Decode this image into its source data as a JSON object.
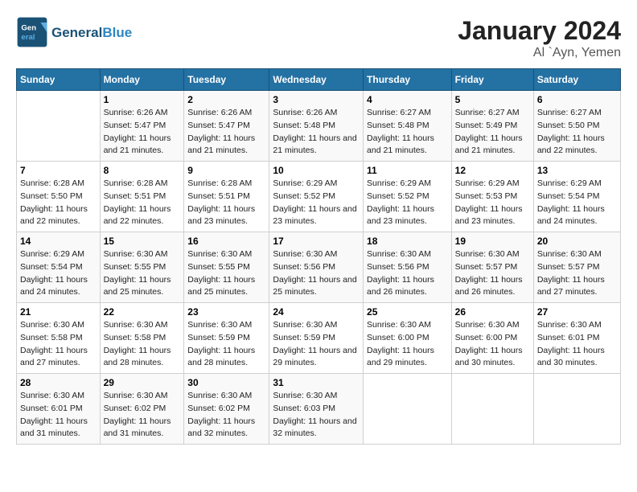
{
  "header": {
    "logo_general": "General",
    "logo_blue": "Blue",
    "title": "January 2024",
    "subtitle": "Al `Ayn, Yemen"
  },
  "days_of_week": [
    "Sunday",
    "Monday",
    "Tuesday",
    "Wednesday",
    "Thursday",
    "Friday",
    "Saturday"
  ],
  "weeks": [
    [
      {
        "day": "",
        "sunrise": "",
        "sunset": "",
        "daylight": ""
      },
      {
        "day": "1",
        "sunrise": "Sunrise: 6:26 AM",
        "sunset": "Sunset: 5:47 PM",
        "daylight": "Daylight: 11 hours and 21 minutes."
      },
      {
        "day": "2",
        "sunrise": "Sunrise: 6:26 AM",
        "sunset": "Sunset: 5:47 PM",
        "daylight": "Daylight: 11 hours and 21 minutes."
      },
      {
        "day": "3",
        "sunrise": "Sunrise: 6:26 AM",
        "sunset": "Sunset: 5:48 PM",
        "daylight": "Daylight: 11 hours and 21 minutes."
      },
      {
        "day": "4",
        "sunrise": "Sunrise: 6:27 AM",
        "sunset": "Sunset: 5:48 PM",
        "daylight": "Daylight: 11 hours and 21 minutes."
      },
      {
        "day": "5",
        "sunrise": "Sunrise: 6:27 AM",
        "sunset": "Sunset: 5:49 PM",
        "daylight": "Daylight: 11 hours and 21 minutes."
      },
      {
        "day": "6",
        "sunrise": "Sunrise: 6:27 AM",
        "sunset": "Sunset: 5:50 PM",
        "daylight": "Daylight: 11 hours and 22 minutes."
      }
    ],
    [
      {
        "day": "7",
        "sunrise": "Sunrise: 6:28 AM",
        "sunset": "Sunset: 5:50 PM",
        "daylight": "Daylight: 11 hours and 22 minutes."
      },
      {
        "day": "8",
        "sunrise": "Sunrise: 6:28 AM",
        "sunset": "Sunset: 5:51 PM",
        "daylight": "Daylight: 11 hours and 22 minutes."
      },
      {
        "day": "9",
        "sunrise": "Sunrise: 6:28 AM",
        "sunset": "Sunset: 5:51 PM",
        "daylight": "Daylight: 11 hours and 23 minutes."
      },
      {
        "day": "10",
        "sunrise": "Sunrise: 6:29 AM",
        "sunset": "Sunset: 5:52 PM",
        "daylight": "Daylight: 11 hours and 23 minutes."
      },
      {
        "day": "11",
        "sunrise": "Sunrise: 6:29 AM",
        "sunset": "Sunset: 5:52 PM",
        "daylight": "Daylight: 11 hours and 23 minutes."
      },
      {
        "day": "12",
        "sunrise": "Sunrise: 6:29 AM",
        "sunset": "Sunset: 5:53 PM",
        "daylight": "Daylight: 11 hours and 23 minutes."
      },
      {
        "day": "13",
        "sunrise": "Sunrise: 6:29 AM",
        "sunset": "Sunset: 5:54 PM",
        "daylight": "Daylight: 11 hours and 24 minutes."
      }
    ],
    [
      {
        "day": "14",
        "sunrise": "Sunrise: 6:29 AM",
        "sunset": "Sunset: 5:54 PM",
        "daylight": "Daylight: 11 hours and 24 minutes."
      },
      {
        "day": "15",
        "sunrise": "Sunrise: 6:30 AM",
        "sunset": "Sunset: 5:55 PM",
        "daylight": "Daylight: 11 hours and 25 minutes."
      },
      {
        "day": "16",
        "sunrise": "Sunrise: 6:30 AM",
        "sunset": "Sunset: 5:55 PM",
        "daylight": "Daylight: 11 hours and 25 minutes."
      },
      {
        "day": "17",
        "sunrise": "Sunrise: 6:30 AM",
        "sunset": "Sunset: 5:56 PM",
        "daylight": "Daylight: 11 hours and 25 minutes."
      },
      {
        "day": "18",
        "sunrise": "Sunrise: 6:30 AM",
        "sunset": "Sunset: 5:56 PM",
        "daylight": "Daylight: 11 hours and 26 minutes."
      },
      {
        "day": "19",
        "sunrise": "Sunrise: 6:30 AM",
        "sunset": "Sunset: 5:57 PM",
        "daylight": "Daylight: 11 hours and 26 minutes."
      },
      {
        "day": "20",
        "sunrise": "Sunrise: 6:30 AM",
        "sunset": "Sunset: 5:57 PM",
        "daylight": "Daylight: 11 hours and 27 minutes."
      }
    ],
    [
      {
        "day": "21",
        "sunrise": "Sunrise: 6:30 AM",
        "sunset": "Sunset: 5:58 PM",
        "daylight": "Daylight: 11 hours and 27 minutes."
      },
      {
        "day": "22",
        "sunrise": "Sunrise: 6:30 AM",
        "sunset": "Sunset: 5:58 PM",
        "daylight": "Daylight: 11 hours and 28 minutes."
      },
      {
        "day": "23",
        "sunrise": "Sunrise: 6:30 AM",
        "sunset": "Sunset: 5:59 PM",
        "daylight": "Daylight: 11 hours and 28 minutes."
      },
      {
        "day": "24",
        "sunrise": "Sunrise: 6:30 AM",
        "sunset": "Sunset: 5:59 PM",
        "daylight": "Daylight: 11 hours and 29 minutes."
      },
      {
        "day": "25",
        "sunrise": "Sunrise: 6:30 AM",
        "sunset": "Sunset: 6:00 PM",
        "daylight": "Daylight: 11 hours and 29 minutes."
      },
      {
        "day": "26",
        "sunrise": "Sunrise: 6:30 AM",
        "sunset": "Sunset: 6:00 PM",
        "daylight": "Daylight: 11 hours and 30 minutes."
      },
      {
        "day": "27",
        "sunrise": "Sunrise: 6:30 AM",
        "sunset": "Sunset: 6:01 PM",
        "daylight": "Daylight: 11 hours and 30 minutes."
      }
    ],
    [
      {
        "day": "28",
        "sunrise": "Sunrise: 6:30 AM",
        "sunset": "Sunset: 6:01 PM",
        "daylight": "Daylight: 11 hours and 31 minutes."
      },
      {
        "day": "29",
        "sunrise": "Sunrise: 6:30 AM",
        "sunset": "Sunset: 6:02 PM",
        "daylight": "Daylight: 11 hours and 31 minutes."
      },
      {
        "day": "30",
        "sunrise": "Sunrise: 6:30 AM",
        "sunset": "Sunset: 6:02 PM",
        "daylight": "Daylight: 11 hours and 32 minutes."
      },
      {
        "day": "31",
        "sunrise": "Sunrise: 6:30 AM",
        "sunset": "Sunset: 6:03 PM",
        "daylight": "Daylight: 11 hours and 32 minutes."
      },
      {
        "day": "",
        "sunrise": "",
        "sunset": "",
        "daylight": ""
      },
      {
        "day": "",
        "sunrise": "",
        "sunset": "",
        "daylight": ""
      },
      {
        "day": "",
        "sunrise": "",
        "sunset": "",
        "daylight": ""
      }
    ]
  ]
}
